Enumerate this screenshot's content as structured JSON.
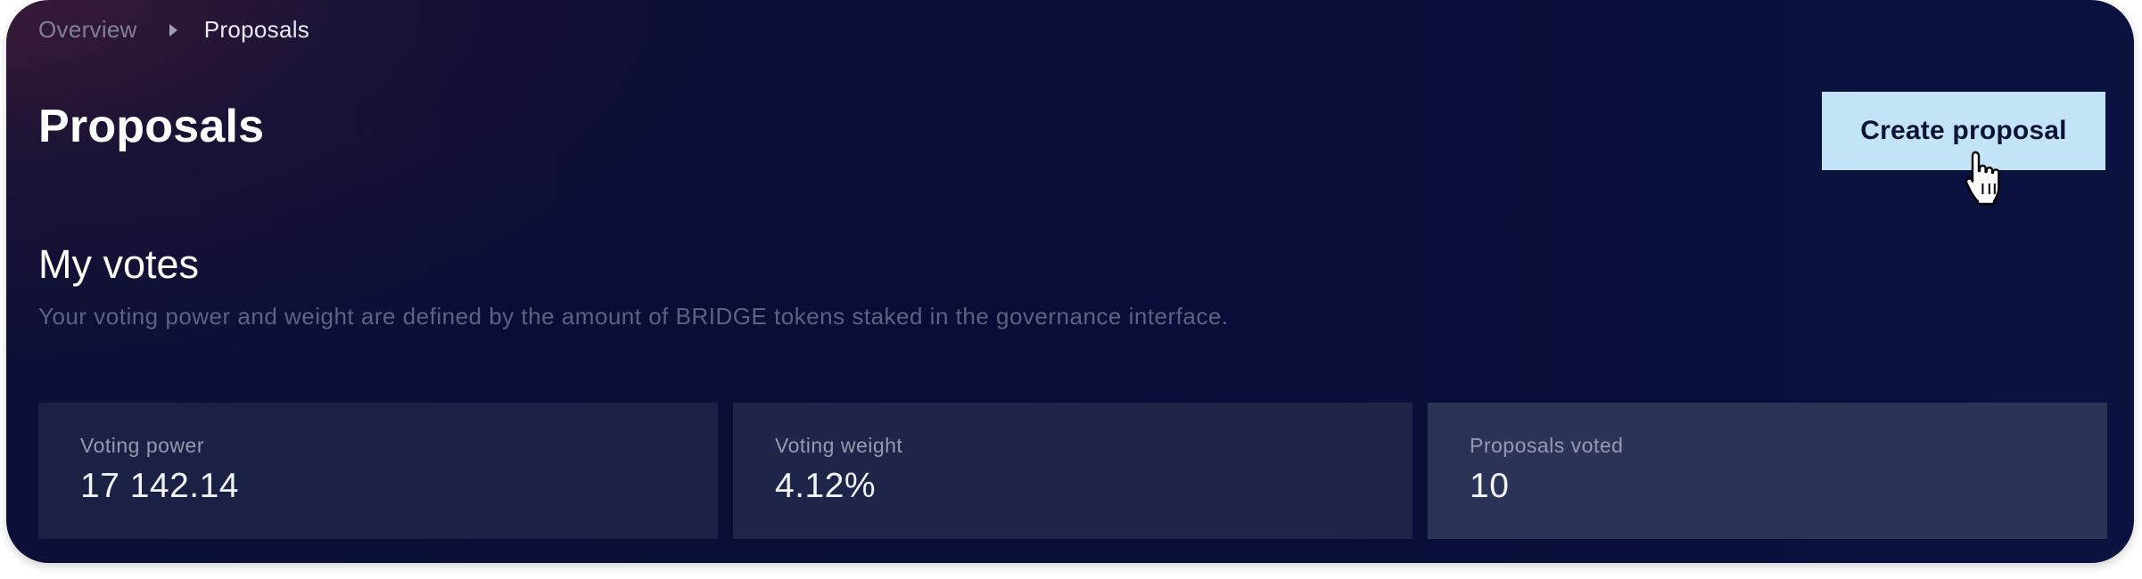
{
  "breadcrumb": {
    "items": [
      "Overview",
      "Proposals"
    ],
    "separator_icon": "caret-right-icon"
  },
  "header": {
    "title": "Proposals",
    "create_button_label": "Create proposal"
  },
  "my_votes": {
    "title": "My votes",
    "description": "Your voting power and weight are defined by the amount of BRIDGE tokens staked in the governance interface."
  },
  "stats": [
    {
      "label": "Voting power",
      "value": "17 142.14"
    },
    {
      "label": "Voting weight",
      "value": "4.12%"
    },
    {
      "label": "Proposals voted",
      "value": "10"
    }
  ],
  "cursor": {
    "icon": "pointer-hand-icon"
  },
  "colors": {
    "accent_button": "#c2e4f6",
    "background": "#080d35",
    "card": "#1a2144"
  }
}
